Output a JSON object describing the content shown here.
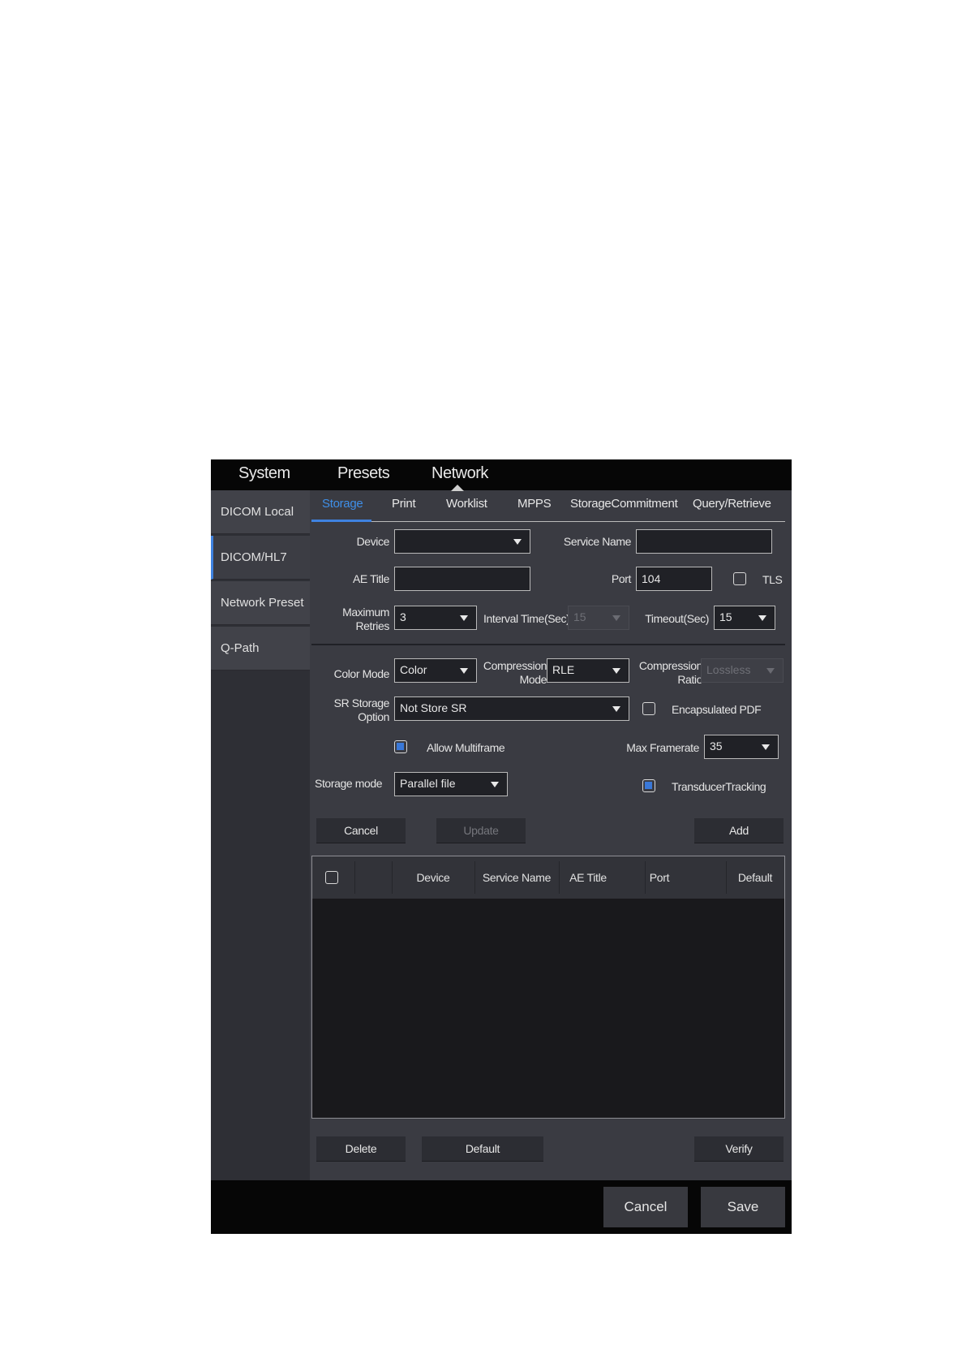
{
  "top_tabs": [
    "System",
    "Presets",
    "Network"
  ],
  "sidebar": {
    "items": [
      {
        "label": "DICOM Local"
      },
      {
        "label": "DICOM/HL7"
      },
      {
        "label": "Network Preset"
      },
      {
        "label": "Q-Path"
      }
    ]
  },
  "sub_tabs": [
    "Storage",
    "Print",
    "Worklist",
    "MPPS",
    "StorageCommitment",
    "Query/Retrieve"
  ],
  "form": {
    "device_label": "Device",
    "device_value": "",
    "service_name_label": "Service Name",
    "service_name_value": "",
    "ae_title_label": "AE Title",
    "ae_title_value": "",
    "port_label": "Port",
    "port_value": "104",
    "tls_label": "TLS",
    "max_retries_label_1": "Maximum",
    "max_retries_label_2": "Retries",
    "max_retries_value": "3",
    "interval_label": "Interval Time(Sec)",
    "interval_value": "15",
    "timeout_label": "Timeout(Sec)",
    "timeout_value": "15",
    "color_mode_label": "Color Mode",
    "color_mode_value": "Color",
    "compression_mode_label_1": "Compression",
    "compression_mode_label_2": "Mode",
    "compression_mode_value": "RLE",
    "compression_ratio_label_1": "Compression",
    "compression_ratio_label_2": "Ratio",
    "compression_ratio_value": "Lossless",
    "sr_storage_label_1": "SR Storage",
    "sr_storage_label_2": "Option",
    "sr_storage_value": "Not Store SR",
    "encapsulated_pdf_label": "Encapsulated PDF",
    "allow_multiframe_label": "Allow Multiframe",
    "max_framerate_label": "Max Framerate",
    "max_framerate_value": "35",
    "storage_mode_label": "Storage mode",
    "storage_mode_value": "Parallel file",
    "transducer_tracking_label": "TransducerTracking"
  },
  "buttons": {
    "cancel": "Cancel",
    "update": "Update",
    "add": "Add",
    "delete": "Delete",
    "default": "Default",
    "verify": "Verify"
  },
  "table": {
    "columns": [
      "Device",
      "Service Name",
      "AE Title",
      "Port",
      "Default"
    ],
    "rows": []
  },
  "footer": {
    "cancel": "Cancel",
    "save": "Save"
  },
  "colors": {
    "accent": "#3f82e0",
    "panel": "#3a3b42",
    "bar": "#060606"
  }
}
